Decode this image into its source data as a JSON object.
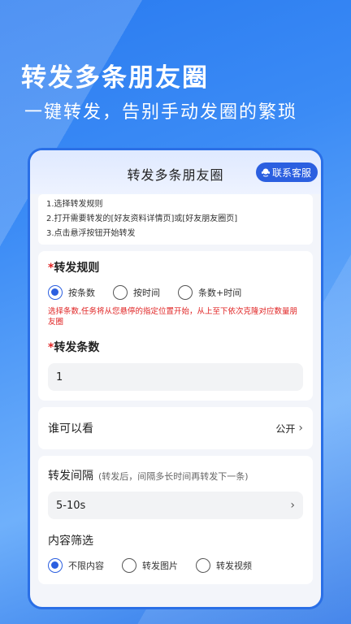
{
  "hero": {
    "title": "转发多条朋友圈",
    "subtitle": "一键转发，告别手动发圈的繁琐"
  },
  "app": {
    "title": "转发多条朋友圈",
    "cs_button": "联系客服"
  },
  "steps": [
    "1.选择转发规则",
    "2.打开需要转发的[好友资料详情页]或[好友朋友圈页]",
    "3.点击悬浮按钮开始转发"
  ],
  "rule": {
    "required_mark": "*",
    "label": "转发规则",
    "options": [
      "按条数",
      "按时间",
      "条数+时间"
    ],
    "selected_index": 0,
    "warning": "选择条数,任务将从您悬停的指定位置开始，从上至下依次克隆对应数量朋友圈"
  },
  "count": {
    "required_mark": "*",
    "label": "转发条数",
    "value": "1"
  },
  "visibility": {
    "label": "谁可以看",
    "value": "公开",
    "chevron": "›"
  },
  "interval": {
    "label": "转发间隔",
    "hint": "(转发后，间隔多长时间再转发下一条)",
    "value": "5-10s",
    "chevron": "›"
  },
  "filter": {
    "label": "内容筛选",
    "options": [
      "不限内容",
      "转发图片",
      "转发视频"
    ],
    "selected_index": 0
  },
  "colors": {
    "accent": "#2b5fe0",
    "warning": "#e02424"
  }
}
